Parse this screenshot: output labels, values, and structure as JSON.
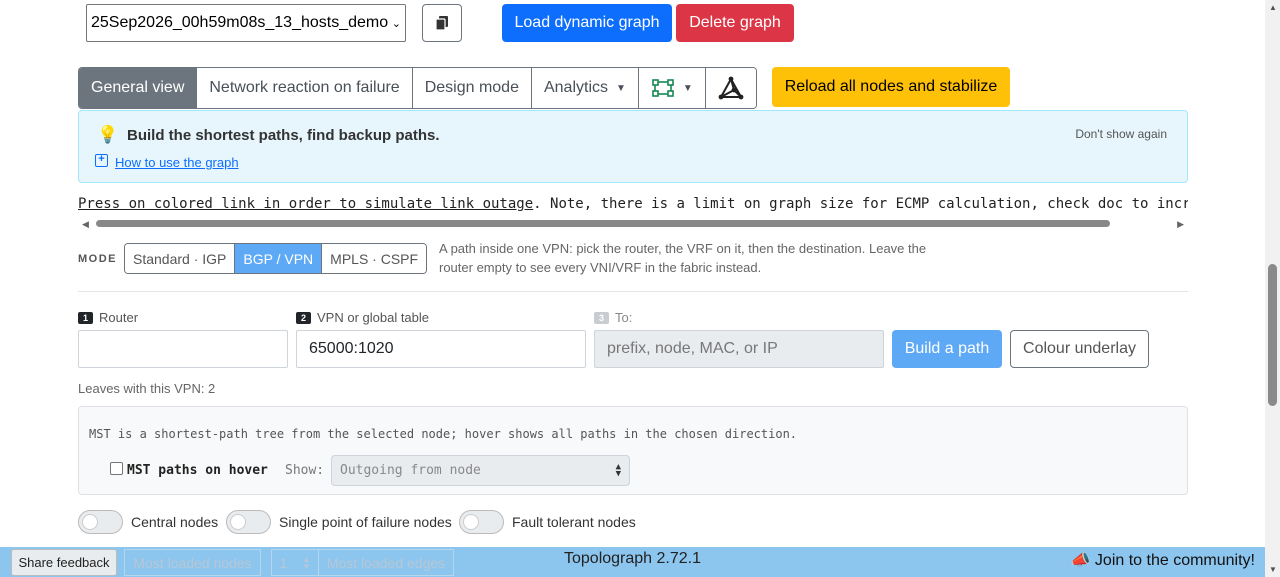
{
  "top": {
    "graph_select_value": "25Sep2026_00h59m08s_13_hosts_demo",
    "load_button": "Load dynamic graph",
    "delete_button": "Delete graph"
  },
  "tabs": {
    "general": "General view",
    "reaction": "Network reaction on failure",
    "design": "Design mode",
    "analytics": "Analytics"
  },
  "reload_button": "Reload all nodes and stabilize",
  "alert": {
    "bulb": "💡",
    "title": "Build the shortest paths, find backup paths.",
    "howto": "How to use the graph",
    "dont_show": "Don't show again"
  },
  "notice": {
    "link_text": "Press on colored link in order to simulate link outage",
    "rest": ". Note, there is a limit on graph size for ECMP calculation, check doc to increase it."
  },
  "mode": {
    "label": "MODE",
    "options": [
      "Standard · IGP",
      "BGP / VPN",
      "MPLS · CSPF"
    ],
    "selected": "BGP / VPN",
    "help": "A path inside one VPN: pick the router, the VRF on it, then the destination. Leave the router empty to see every VNI/VRF in the fabric instead."
  },
  "path": {
    "step1": {
      "num": "1",
      "label": "Router",
      "value": ""
    },
    "step2": {
      "num": "2",
      "label": "VPN or global table",
      "value": "65000:1020"
    },
    "step3": {
      "num": "3",
      "label": "To:",
      "placeholder": "prefix, node, MAC, or IP"
    },
    "build_button": "Build a path",
    "underlay_button": "Colour underlay",
    "leaves_text": "Leaves with this VPN: 2"
  },
  "mst": {
    "description": "MST is a shortest-path tree from the selected node; hover shows all paths in the chosen direction.",
    "checkbox_label": "MST paths on hover",
    "show_label": "Show:",
    "direction": "Outgoing from node"
  },
  "toggles": [
    {
      "label": "Central nodes",
      "on": false
    },
    {
      "label": "Single point of failure nodes",
      "on": false
    },
    {
      "label": "Fault tolerant nodes",
      "on": false
    }
  ],
  "footer": {
    "feedback": "Share feedback",
    "most_loaded_nodes": "Most loaded nodes",
    "count_value": "1",
    "most_loaded_edges": "Most loaded edges",
    "version": "Topolograph 2.72.1",
    "community": "📣 Join to the community!"
  },
  "colors": {
    "primary": "#0d6efd",
    "danger": "#dc3545",
    "warning": "#ffc107",
    "active_tab": "#6c757d",
    "footer": "#8cc5ee",
    "mode_active": "#5ea9f5"
  }
}
